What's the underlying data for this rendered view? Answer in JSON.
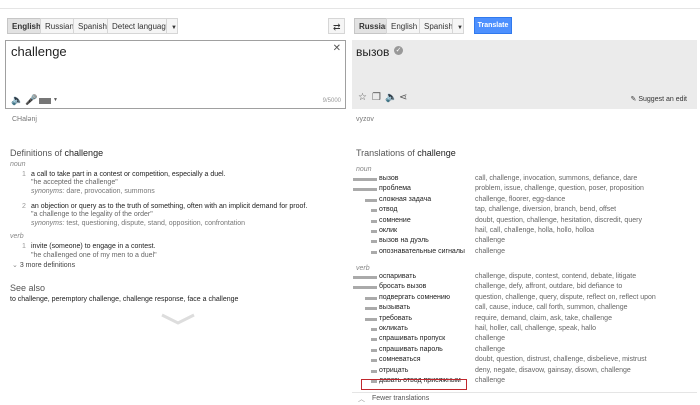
{
  "source_langs": [
    "English",
    "Russian",
    "Spanish",
    "Detect language"
  ],
  "target_langs": [
    "Russian",
    "English",
    "Spanish"
  ],
  "translate_label": "Translate",
  "source": {
    "text": "challenge",
    "char_count": "9/5000",
    "phonetic": "CHalənj"
  },
  "target": {
    "text": "вызов",
    "transliteration": "vyzov",
    "suggest_edit": "Suggest an edit"
  },
  "definitions": {
    "title_prefix": "Definitions of",
    "word": "challenge",
    "noun_label": "noun",
    "noun_defs": [
      {
        "num": "1",
        "text": "a call to take part in a contest or competition, especially a duel.",
        "example": "\"he accepted the challenge\"",
        "syn_label": "synonyms:",
        "synonyms": "dare, provocation, summons"
      },
      {
        "num": "2",
        "text": "an objection or query as to the truth of something, often with an implicit demand for proof.",
        "example": "\"a challenge to the legality of the order\"",
        "syn_label": "synonyms:",
        "synonyms": "test, questioning, dispute, stand, opposition, confrontation"
      }
    ],
    "verb_label": "verb",
    "verb_defs": [
      {
        "num": "1",
        "text": "invite (someone) to engage in a contest.",
        "example": "\"he challenged one of my men to a duel\""
      }
    ],
    "more": "3 more definitions"
  },
  "see_also": {
    "title": "See also",
    "text": "to challenge, peremptory challenge, challenge response, face a challenge"
  },
  "translations": {
    "title_prefix": "Translations of",
    "word": "challenge",
    "noun_label": "noun",
    "noun_rows": [
      {
        "word": "вызов",
        "freq": 1.0,
        "syn": "call, challenge, invocation, summons, defiance, dare"
      },
      {
        "word": "проблема",
        "freq": 1.0,
        "syn": "problem, issue, challenge, question, poser, proposition"
      },
      {
        "word": "сложная задача",
        "freq": 0.5,
        "syn": "challenge, floorer, egg-dance"
      },
      {
        "word": "отвод",
        "freq": 0.25,
        "syn": "tap, challenge, diversion, branch, bend, offset"
      },
      {
        "word": "сомнение",
        "freq": 0.25,
        "syn": "doubt, question, challenge, hesitation, discredit, query"
      },
      {
        "word": "оклик",
        "freq": 0.25,
        "syn": "hail, call, challenge, holla, hollo, holloa"
      },
      {
        "word": "вызов на дуэль",
        "freq": 0.25,
        "syn": "challenge"
      },
      {
        "word": "опознавательные сигналы",
        "freq": 0.25,
        "syn": "challenge"
      }
    ],
    "verb_label": "verb",
    "verb_rows": [
      {
        "word": "оспаривать",
        "freq": 1.0,
        "syn": "challenge, dispute, contest, contend, debate, litigate"
      },
      {
        "word": "бросать вызов",
        "freq": 1.0,
        "syn": "challenge, defy, affront, outdare, bid defiance to"
      },
      {
        "word": "подвергать сомнению",
        "freq": 0.5,
        "syn": "question, challenge, query, dispute, reflect on, reflect upon"
      },
      {
        "word": "вызывать",
        "freq": 0.5,
        "syn": "call, cause, induce, call forth, summon, challenge"
      },
      {
        "word": "требовать",
        "freq": 0.5,
        "syn": "require, demand, claim, ask, take, challenge"
      },
      {
        "word": "окликать",
        "freq": 0.25,
        "syn": "hail, holler, call, challenge, speak, hallo"
      },
      {
        "word": "спрашивать пропуск",
        "freq": 0.25,
        "syn": "challenge"
      },
      {
        "word": "спрашивать пароль",
        "freq": 0.25,
        "syn": "challenge"
      },
      {
        "word": "сомневаться",
        "freq": 0.25,
        "syn": "doubt, question, distrust, challenge, disbelieve, mistrust"
      },
      {
        "word": "отрицать",
        "freq": 0.25,
        "syn": "deny, negate, disavow, gainsay, disown, challenge"
      },
      {
        "word": "давать отвод присяжным",
        "freq": 0.25,
        "syn": "challenge"
      }
    ],
    "fewer": "Fewer translations"
  },
  "colors": {
    "translate_button": "#4d90fe",
    "highlight_border": "#c0282d",
    "target_bg": "#ebebeb"
  }
}
